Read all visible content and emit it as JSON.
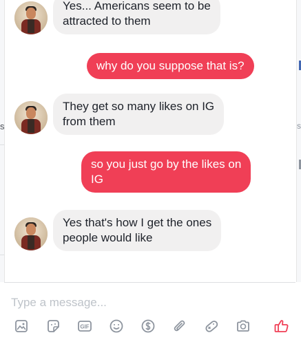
{
  "messages": [
    {
      "direction": "in",
      "lines": [
        "Yes... Americans seem to be",
        "attracted to them"
      ]
    },
    {
      "direction": "out",
      "lines": [
        "why do you suppose that is?"
      ]
    },
    {
      "direction": "in",
      "lines": [
        "They get so many likes on IG",
        "from them"
      ]
    },
    {
      "direction": "out",
      "lines": [
        "so you just go by the likes on",
        "IG"
      ]
    },
    {
      "direction": "in",
      "lines": [
        "Yes that's how I get the ones",
        "people would like"
      ]
    }
  ],
  "composer": {
    "placeholder": "Type a message...",
    "gif_label": "GIF"
  },
  "tools": [
    "photo-icon",
    "sticker-icon",
    "gif-icon",
    "emoji-icon",
    "payment-icon",
    "attachment-icon",
    "game-icon",
    "camera-icon",
    "thumbs-up-icon"
  ],
  "colors": {
    "accent": "#f03f56",
    "incoming_bubble": "#f1f0f0",
    "tool_icon": "#8d949e"
  },
  "background_edge": {
    "left_chars": [
      "s"
    ],
    "right_chars": [
      "s"
    ]
  }
}
